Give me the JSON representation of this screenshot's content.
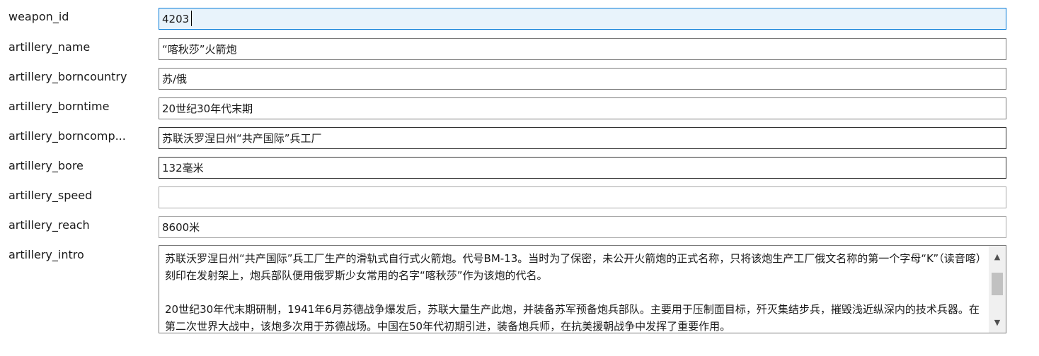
{
  "form": {
    "fields": [
      {
        "label": "weapon_id",
        "value": "4203"
      },
      {
        "label": "artillery_name",
        "value": "“喀秋莎”火箭炮"
      },
      {
        "label": "artillery_borncountry",
        "value": "苏/俄"
      },
      {
        "label": "artillery_borntime",
        "value": "20世纪30年代末期"
      },
      {
        "label": "artillery_borncomp...",
        "value": "苏联沃罗涅日州“共产国际”兵工厂"
      },
      {
        "label": "artillery_bore",
        "value": "132毫米"
      },
      {
        "label": "artillery_speed",
        "value": ""
      },
      {
        "label": "artillery_reach",
        "value": "8600米"
      }
    ],
    "intro": {
      "label": "artillery_intro",
      "paragraph1": "苏联沃罗涅日州“共产国际”兵工厂生产的滑轨式自行式火箭炮。代号BM-13。当时为了保密，未公开火箭炮的正式名称，只将该炮生产工厂俄文名称的第一个字母“K”（读音喀）刻印在发射架上，炮兵部队便用俄罗斯少女常用的名字“喀秋莎”作为该炮的代名。",
      "paragraph2": "20世纪30年代末期研制，1941年6月苏德战争爆发后，苏联大量生产此炮，并装备苏军预备炮兵部队。主要用于压制面目标，歼灭集结步兵，摧毁浅近纵深内的技术兵器。在第二次世界大战中，该炮多次用于苏德战场。中国在50年代初期引进，装备炮兵师，在抗美援朝战争中发挥了重要作用。"
    }
  },
  "icons": {
    "scroll_up": "▲",
    "scroll_down": "▼"
  },
  "colors": {
    "focus_border": "#0078d7",
    "focus_background": "#e8f3fb",
    "border": "#7a7a7a"
  }
}
